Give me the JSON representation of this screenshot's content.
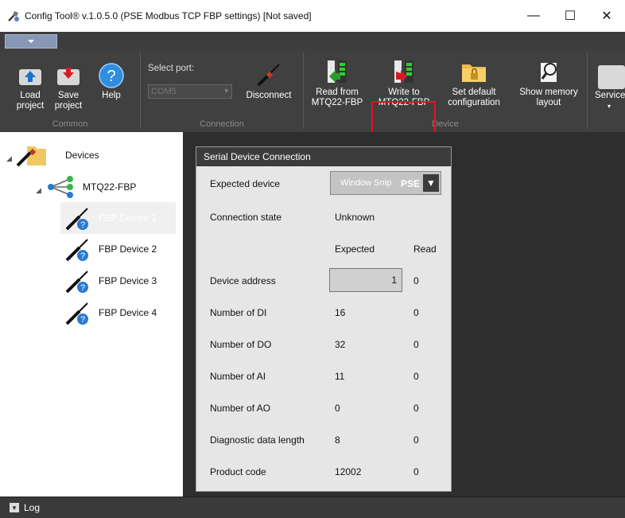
{
  "window": {
    "title": "Config Tool® v.1.0.5.0 (PSE Modbus TCP FBP settings) [Not saved]",
    "minimize": "—",
    "maximize": "☐",
    "close": "✕"
  },
  "ribbon": {
    "common": {
      "caption": "Common",
      "load": "Load project",
      "save": "Save project",
      "help": "Help"
    },
    "connection": {
      "caption": "Connection",
      "select_port_label": "Select port:",
      "port_value": "COM5",
      "disconnect": "Disconnect"
    },
    "device": {
      "caption": "Device",
      "read_from": "Read from MTQ22-FBP",
      "write_to": "Write to MTQ22-FBP",
      "set_default": "Set default configuration",
      "show_memory": "Show memory layout"
    },
    "service": "Service"
  },
  "tree": {
    "root": "Devices",
    "controller": "MTQ22-FBP",
    "devices": [
      "FBP Device 1",
      "FBP Device 2",
      "FBP Device 3",
      "FBP Device 4"
    ]
  },
  "panel": {
    "title": "Serial Device Connection",
    "expected_device_label": "Expected device",
    "expected_device_value": "PSE",
    "expected_device_ghost": "Window Snip",
    "connection_state_label": "Connection state",
    "connection_state_value": "Unknown",
    "col_expected": "Expected",
    "col_read": "Read",
    "rows": [
      {
        "label": "Device address",
        "expected": "1",
        "read": "0"
      },
      {
        "label": "Number of DI",
        "expected": "16",
        "read": "0"
      },
      {
        "label": "Number of DO",
        "expected": "32",
        "read": "0"
      },
      {
        "label": "Number of AI",
        "expected": "11",
        "read": "0"
      },
      {
        "label": "Number of AO",
        "expected": "0",
        "read": "0"
      },
      {
        "label": "Diagnostic data length",
        "expected": "8",
        "read": "0"
      },
      {
        "label": "Product code",
        "expected": "12002",
        "read": "0"
      }
    ]
  },
  "log": {
    "label": "Log"
  }
}
